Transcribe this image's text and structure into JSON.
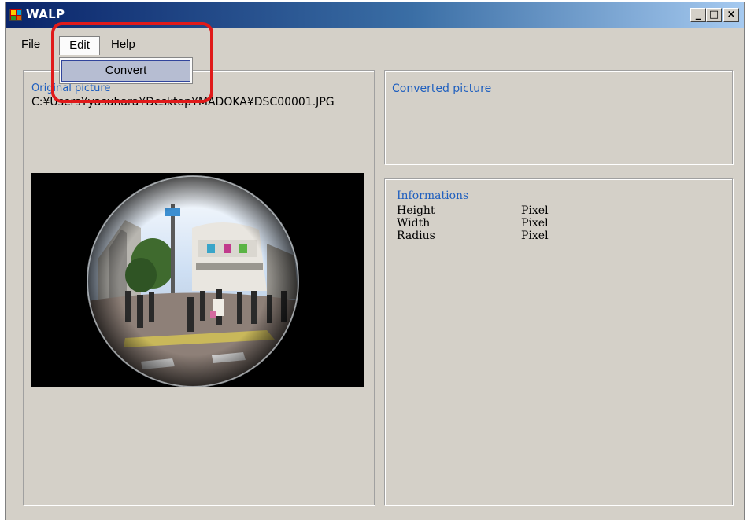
{
  "window": {
    "title": "WALP",
    "controls": {
      "minimize": "_",
      "maximize": "□",
      "close": "×"
    }
  },
  "menu": {
    "file": "File",
    "edit": "Edit",
    "help": "Help",
    "edit_dropdown": {
      "convert": "Convert"
    }
  },
  "original": {
    "label": "Original picture",
    "path": "C:¥Users¥yasuhara¥Desktop¥MADOKA¥DSC00001.JPG"
  },
  "converted": {
    "label": "Converted picture"
  },
  "informations": {
    "label": "Informations",
    "rows": [
      {
        "name": "Height",
        "unit": "Pixel"
      },
      {
        "name": "Width",
        "unit": "Pixel"
      },
      {
        "name": "Radius",
        "unit": "Pixel"
      }
    ]
  },
  "colors": {
    "group_label": "#1f5fbf",
    "highlight": "#e01a1a",
    "window_bg": "#d4d0c8",
    "selected_item": "#b6bdd2"
  },
  "icons": {
    "app": "app-icon",
    "minimize": "minimize-icon",
    "maximize": "maximize-icon",
    "close": "close-icon"
  }
}
